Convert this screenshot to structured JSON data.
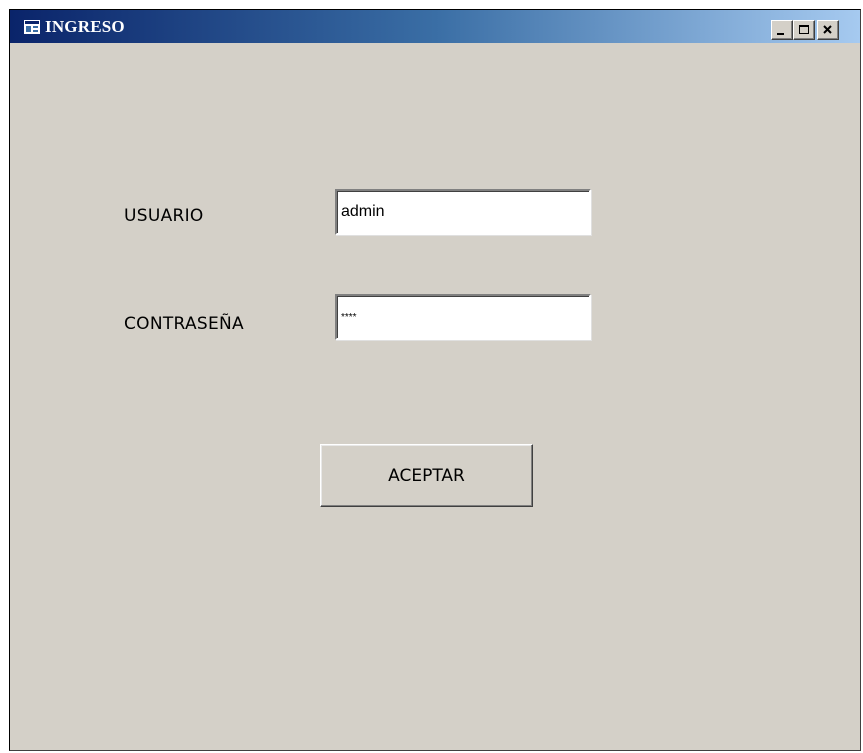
{
  "window": {
    "title": "INGRESO",
    "controls": {
      "minimize": "minimize",
      "maximize": "maximize",
      "close": "close"
    }
  },
  "form": {
    "username_label": "USUARIO",
    "username_value": "admin",
    "password_label": "CONTRASEÑA",
    "password_value": "****",
    "submit_label": "ACEPTAR"
  },
  "icons": {
    "title": "app-window-icon",
    "minimize": "minimize-icon",
    "maximize": "maximize-icon",
    "close": "close-icon"
  },
  "colors": {
    "titlebar_start": "#0a246a",
    "titlebar_end": "#a6caf0",
    "window_bg": "#d4d0c8"
  }
}
